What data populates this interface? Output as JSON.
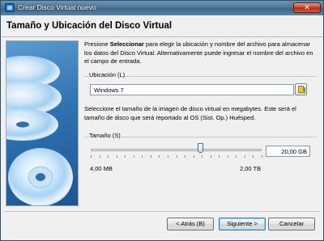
{
  "window": {
    "title": "Crear Disco Virtual nuevo",
    "close_label": "✕"
  },
  "header": {
    "title": "Tamaño y Ubicación del Disco Virtual"
  },
  "intro": {
    "prefix": "Presione ",
    "bold": "Seleccionar",
    "suffix": " para elegir la ubicación y nombre del archivo para almacenar los datos del Disco Virtual. Alternativamente puede ingresar el nombre del archivo en el campo de entrada."
  },
  "location": {
    "label": "Ubicación (L)",
    "value": "Windows 7",
    "browse_icon": "folder-icon"
  },
  "size_desc": "Seleccione el tamaño de la imagen de disco virtual en megabytes. Este será el tamaño de disco que será reportado al OS (Sist. Op.) Huésped.",
  "size": {
    "label": "Tamaño (S)",
    "value": "20,00 GB",
    "slider_position": 0.64,
    "min_label": "4,00 MB",
    "max_label": "2,00 TB"
  },
  "buttons": {
    "back": "< Atrás (B)",
    "next": "Siguiente >",
    "cancel": "Cancelar"
  },
  "colors": {
    "title_bar": "#4d7897",
    "side_panel": "#2f73b2",
    "close_button": "#c2412b"
  }
}
